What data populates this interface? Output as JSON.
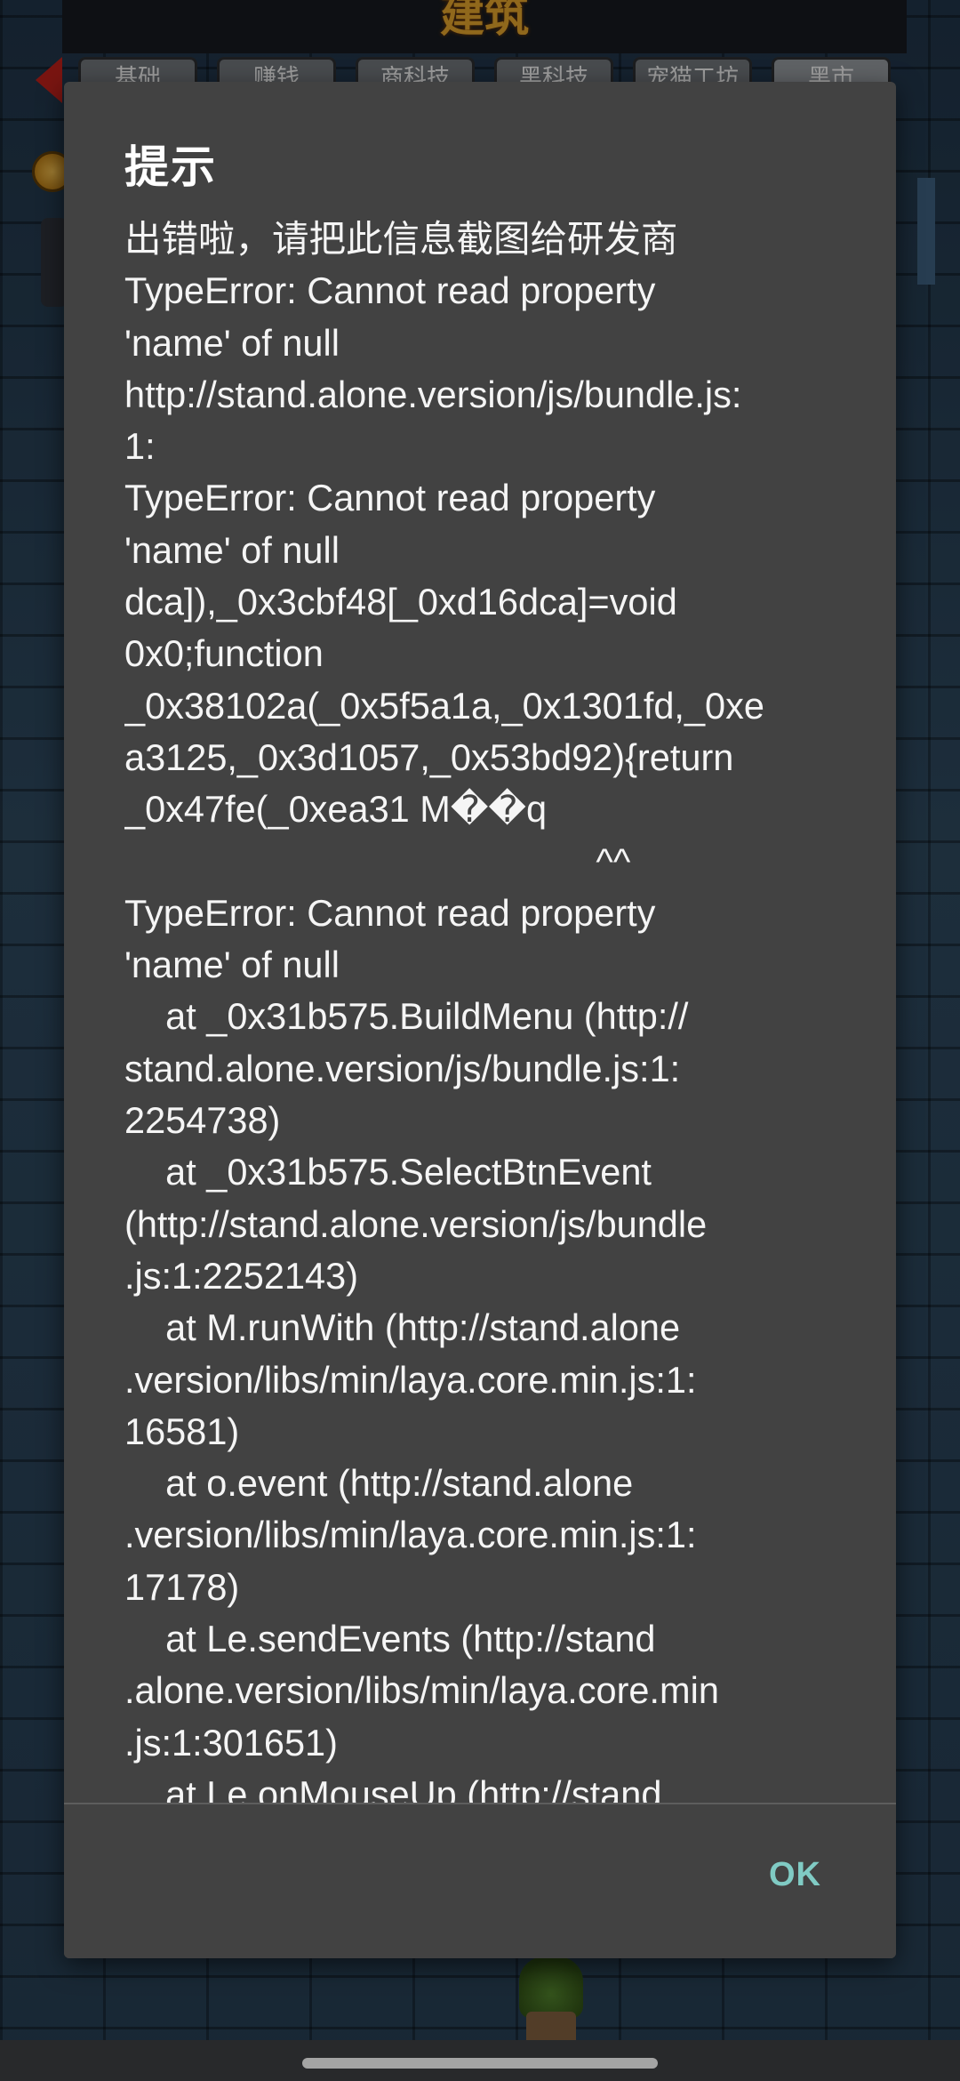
{
  "game": {
    "title": "建筑",
    "tabs": [
      "基础",
      "赚钱",
      "商科技",
      "黑科技",
      "宠猫工坊",
      "黑市"
    ]
  },
  "dialog": {
    "title": "提示",
    "message": "出错啦，请把此信息截图给研发商\nTypeError: Cannot read property\n'name' of null\nhttp://stand.alone.version/js/bundle.js:\n1:\nTypeError: Cannot read property\n'name' of null\ndca]),_0x3cbf48[_0xd16dca]=void\n0x0;function\n_0x38102a(_0x5f5a1a,_0x1301fd,_0xe\na3125,_0x3d1057,_0x53bd92){return\n_0x47fe(_0xea31 M��q\n                                              ^^\nTypeError: Cannot read property\n'name' of null\n    at _0x31b575.BuildMenu (http://\nstand.alone.version/js/bundle.js:1:\n2254738)\n    at _0x31b575.SelectBtnEvent\n(http://stand.alone.version/js/bundle\n.js:1:2252143)\n    at M.runWith (http://stand.alone\n.version/libs/min/laya.core.min.js:1:\n16581)\n    at o.event (http://stand.alone\n.version/libs/min/laya.core.min.js:1:\n17178)\n    at Le.sendEvents (http://stand\n.alone.version/libs/min/laya.core.min\n.js:1:301651)\n    at Le.onMouseUp (http://stand",
    "ok_label": "OK"
  },
  "colors": {
    "dialog_bg": "#424242",
    "text": "#ffffff",
    "accent": "#80cbc4"
  }
}
